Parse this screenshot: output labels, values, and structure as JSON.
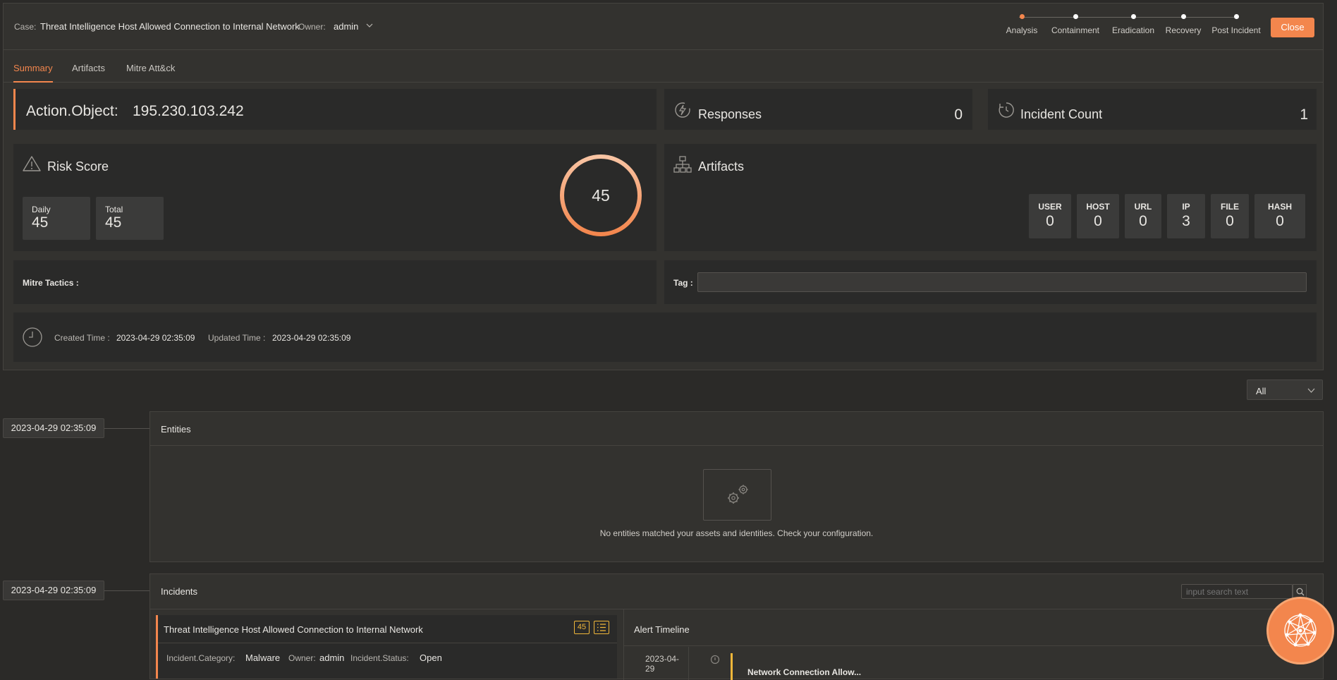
{
  "header": {
    "case_label": "Case:",
    "case_title": "Threat Intelligence Host Allowed Connection to Internal Network",
    "owner_label": "Owner:",
    "owner_value": "admin",
    "stages": [
      "Analysis",
      "Containment",
      "Eradication",
      "Recovery",
      "Post Incident"
    ],
    "close_label": "Close"
  },
  "tabs": [
    "Summary",
    "Artifacts",
    "Mitre Att&ck"
  ],
  "action": {
    "label": "Action.Object:",
    "value": "195.230.103.242"
  },
  "responses": {
    "label": "Responses",
    "value": "0"
  },
  "incident_count": {
    "label": "Incident Count",
    "value": "1"
  },
  "risk": {
    "title": "Risk Score",
    "daily_label": "Daily",
    "daily_value": "45",
    "total_label": "Total",
    "total_value": "45",
    "gauge_value": "45"
  },
  "artifacts": {
    "title": "Artifacts",
    "items": [
      {
        "label": "USER",
        "value": "0"
      },
      {
        "label": "HOST",
        "value": "0"
      },
      {
        "label": "URL",
        "value": "0"
      },
      {
        "label": "IP",
        "value": "3"
      },
      {
        "label": "FILE",
        "value": "0"
      },
      {
        "label": "HASH",
        "value": "0"
      }
    ]
  },
  "mitre": {
    "label": "Mitre Tactics :"
  },
  "tag": {
    "label": "Tag :",
    "value": ""
  },
  "times": {
    "created_label": "Created Time :",
    "created_value": "2023-04-29 02:35:09",
    "updated_label": "Updated Time :",
    "updated_value": "2023-04-29 02:35:09"
  },
  "filter": {
    "selected": "All"
  },
  "entities": {
    "timestamp": "2023-04-29 02:35:09",
    "title": "Entities",
    "empty_text": "No entities matched your assets and identities. Check your configuration."
  },
  "incidents": {
    "timestamp": "2023-04-29 02:35:09",
    "title": "Incidents",
    "search_placeholder": "input search text",
    "item": {
      "title": "Threat Intelligence Host Allowed Connection to Internal Network",
      "score": "45",
      "category_label": "Incident.Category:",
      "category_value": "Malware",
      "owner_label": "Owner:",
      "owner_value": "admin",
      "status_label": "Incident.Status:",
      "status_value": "Open"
    },
    "timeline": {
      "title": "Alert Timeline",
      "first_date": "2023-04-29",
      "first_event": "Network Connection Allow..."
    }
  },
  "colors": {
    "accent": "#f3864d",
    "background": "#2b2a28",
    "panel": "#33322f",
    "card": "#2a2a29"
  }
}
